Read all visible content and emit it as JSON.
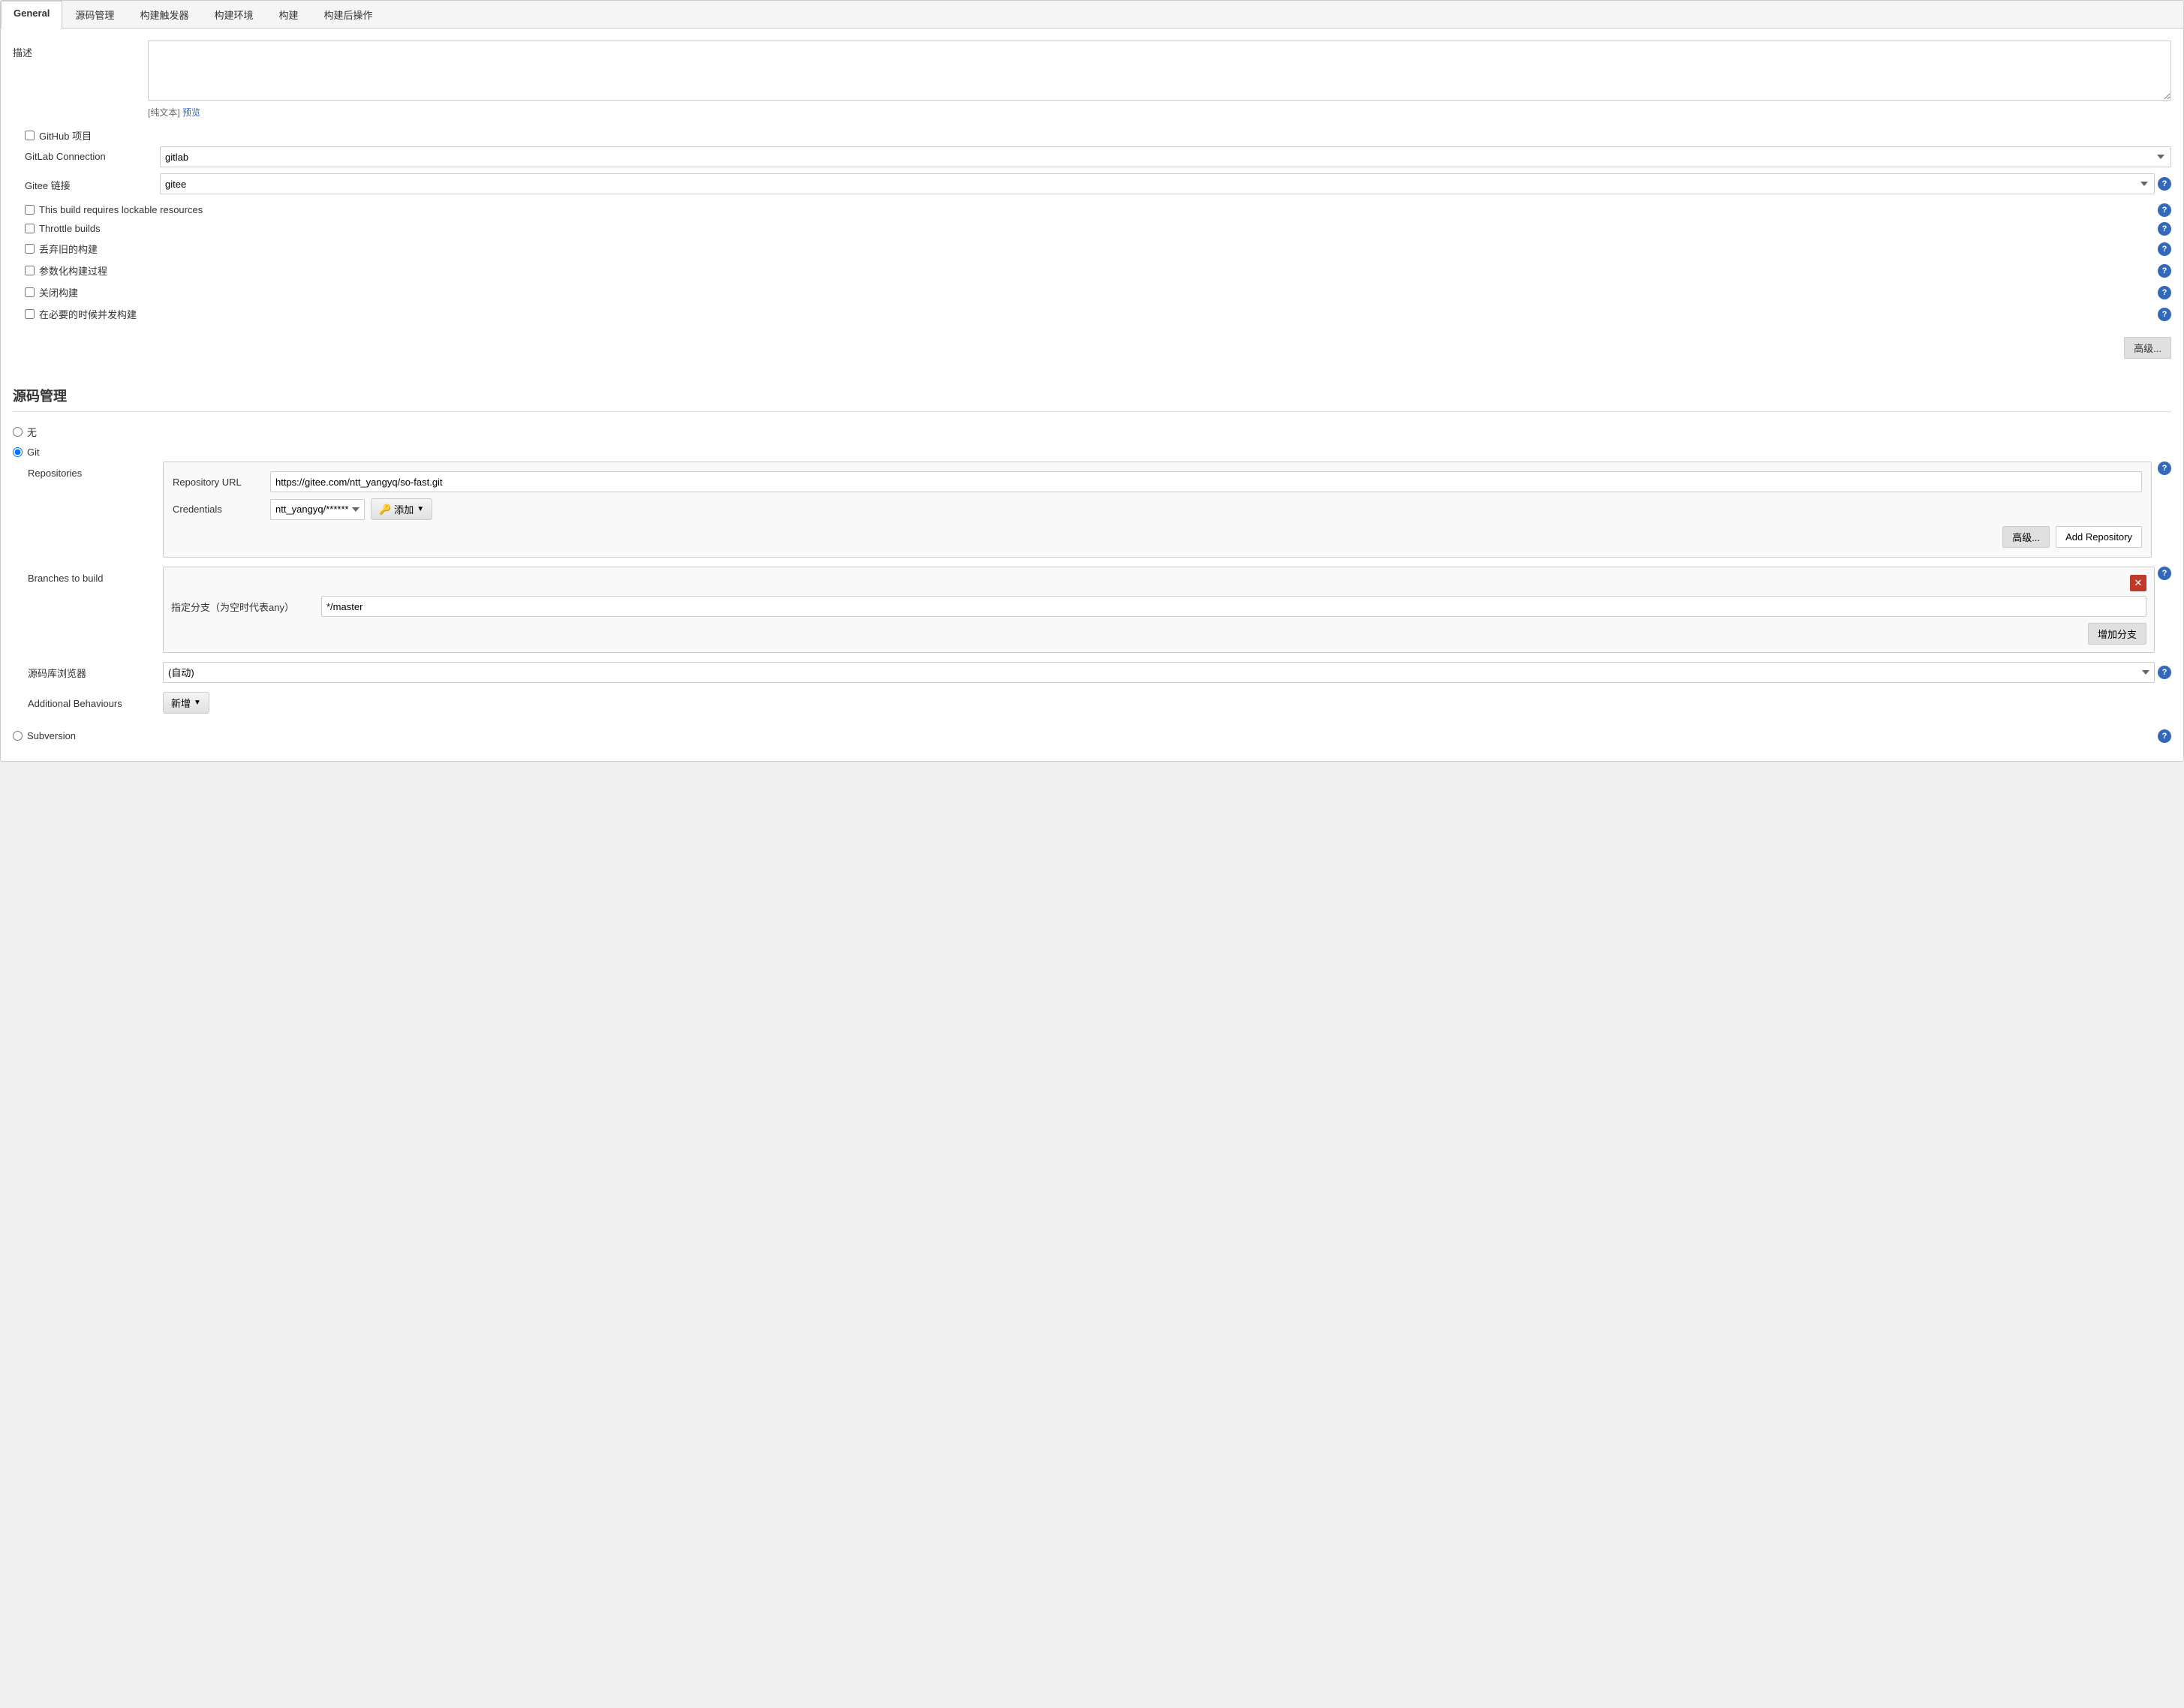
{
  "tabs": [
    {
      "id": "general",
      "label": "General",
      "active": true
    },
    {
      "id": "scm",
      "label": "源码管理",
      "active": false
    },
    {
      "id": "triggers",
      "label": "构建触发器",
      "active": false
    },
    {
      "id": "env",
      "label": "构建环境",
      "active": false
    },
    {
      "id": "build",
      "label": "构建",
      "active": false
    },
    {
      "id": "post",
      "label": "构建后操作",
      "active": false
    }
  ],
  "general": {
    "description_label": "描述",
    "description_placeholder": "",
    "plain_text_label": "[纯文本]",
    "preview_label": "预览",
    "github_project_label": "GitHub 项目",
    "gitlab_connection_label": "GitLab Connection",
    "gitlab_value": "gitlab",
    "gitee_link_label": "Gitee 链接",
    "gitee_value": "gitee",
    "lockable_label": "This build requires lockable resources",
    "throttle_label": "Throttle builds",
    "discard_label": "丢弃旧的构建",
    "parameterized_label": "参数化构建过程",
    "disable_label": "关闭构建",
    "concurrent_label": "在必要的时候并发构建",
    "advanced_btn": "高级..."
  },
  "scm": {
    "section_title": "源码管理",
    "none_label": "无",
    "git_label": "Git",
    "repositories_label": "Repositories",
    "repo_url_label": "Repository URL",
    "repo_url_value": "https://gitee.com/ntt_yangyq/so-fast.git",
    "credentials_label": "Credentials",
    "credentials_value": "ntt_yangyq/******",
    "add_btn_label": "添加",
    "key_icon": "🔑",
    "advanced_btn": "高级...",
    "add_repository_btn": "Add Repository",
    "branches_label": "Branches to build",
    "branch_spec_label": "指定分支（为空时代表any）",
    "branch_value": "*/master",
    "add_branch_btn": "增加分支",
    "browser_label": "源码库浏览器",
    "browser_value": "(自动)",
    "additional_label": "Additional Behaviours",
    "add_new_btn": "新增",
    "subversion_label": "Subversion"
  },
  "colors": {
    "tab_active_bg": "#ffffff",
    "help_icon_bg": "#3468b8",
    "delete_btn_bg": "#c0392b",
    "radio_selected": "#3468b8"
  }
}
